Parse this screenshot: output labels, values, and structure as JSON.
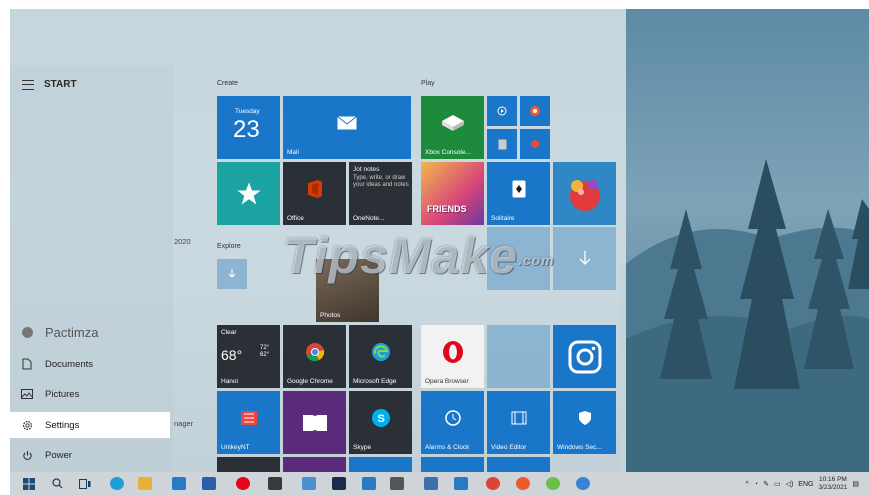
{
  "start_menu": {
    "title": "START",
    "user_name": "Pactimza",
    "rail": [
      {
        "label": "Documents",
        "icon": "document-icon"
      },
      {
        "label": "Pictures",
        "icon": "pictures-icon"
      },
      {
        "label": "Settings",
        "icon": "gear-icon"
      },
      {
        "label": "Power",
        "icon": "power-icon"
      }
    ],
    "fragments": {
      "year": "2020",
      "manager": "nager"
    }
  },
  "groups": {
    "create": "Create",
    "explore": "Explore",
    "play": "Play"
  },
  "tiles": {
    "calendar": {
      "day": "Tuesday",
      "date": "23"
    },
    "mail": "Mail",
    "xbox": "Xbox Console...",
    "office": "Office",
    "onenote": {
      "label": "OneNote...",
      "title": "Jot notes",
      "body": "Type, write, or draw your ideas and notes"
    },
    "friends": "FRIENDS",
    "solitaire": "Solitaire",
    "photos": "Photos",
    "weather": {
      "condition": "Clear",
      "temp": "68°",
      "hi": "72°",
      "lo": "62°",
      "city": "Hanoi"
    },
    "chrome": "Google Chrome",
    "edge": "Microsoft Edge",
    "opera": "Opera Browser",
    "unikey": "UnikeyNT",
    "skype": "Skype",
    "alarms": "Alarms & Clock",
    "video_editor": "Video Editor",
    "windows_security": "Windows Sec..."
  },
  "watermark": {
    "main": "TipsMake",
    "suffix": ".com"
  },
  "taskbar": {
    "tray_lang": "ENG",
    "time": "10:16 PM",
    "date": "3/23/2021"
  }
}
